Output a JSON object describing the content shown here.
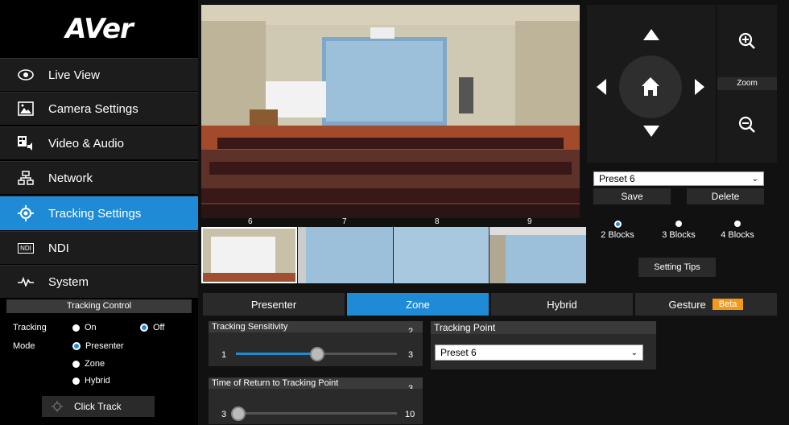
{
  "brand": {
    "logo_text": "AVer"
  },
  "sidebar": {
    "items": [
      {
        "label": "Live View",
        "icon": "eye-icon"
      },
      {
        "label": "Camera Settings",
        "icon": "image-icon"
      },
      {
        "label": "Video & Audio",
        "icon": "video-audio-icon"
      },
      {
        "label": "Network",
        "icon": "network-icon"
      },
      {
        "label": "Tracking Settings",
        "icon": "target-icon",
        "active": true
      },
      {
        "label": "NDI",
        "icon": "ndi-icon"
      },
      {
        "label": "System",
        "icon": "pulse-icon"
      }
    ],
    "ndi_icon_text": "NDI"
  },
  "tracking_control": {
    "header": "Tracking Control",
    "tracking_label": "Tracking",
    "on_label": "On",
    "off_label": "Off",
    "mode_label": "Mode",
    "modes": [
      "Presenter",
      "Zone",
      "Hybrid"
    ],
    "selected_mode": "Presenter",
    "tracking_state": "Off",
    "click_track_label": "Click Track"
  },
  "preview": {
    "thumb_numbers": [
      "6",
      "7",
      "8",
      "9"
    ]
  },
  "ptz": {
    "zoom_label": "Zoom"
  },
  "preset": {
    "selected": "Preset 6",
    "save_label": "Save",
    "delete_label": "Delete",
    "blocks": [
      "2 Blocks",
      "3 Blocks",
      "4 Blocks"
    ],
    "selected_blocks": "2 Blocks",
    "setting_tips_label": "Setting Tips"
  },
  "tabs": {
    "items": [
      "Presenter",
      "Zone",
      "Hybrid",
      "Gesture"
    ],
    "active": "Zone",
    "beta_label": "Beta"
  },
  "settings": {
    "tracking_sensitivity": {
      "label": "Tracking Sensitivity",
      "value": "2",
      "min": "1",
      "max": "3"
    },
    "return_time": {
      "label": "Time of Return to Tracking Point",
      "value": "3",
      "min": "3",
      "max": "10"
    },
    "tracking_point": {
      "label": "Tracking Point",
      "selected": "Preset 6"
    }
  },
  "colors": {
    "accent": "#1f8bd6",
    "beta": "#f39a1a"
  }
}
